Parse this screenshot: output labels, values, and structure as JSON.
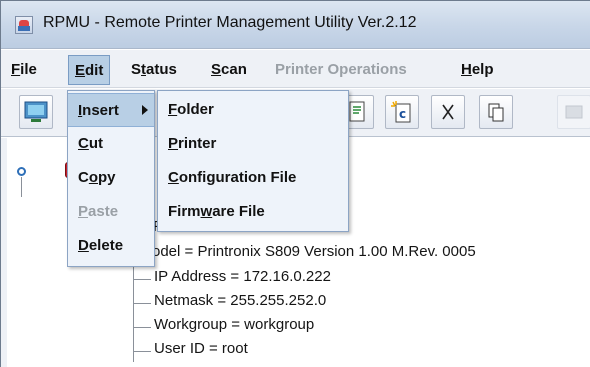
{
  "window": {
    "title": "RPMU - Remote Printer Management Utility Ver.2.12"
  },
  "menubar": {
    "file": {
      "pre": "",
      "u": "F",
      "post": "ile"
    },
    "edit": {
      "pre": "",
      "u": "E",
      "post": "dit"
    },
    "status": {
      "pre": "S",
      "u": "t",
      "post": "atus"
    },
    "scan": {
      "pre": "",
      "u": "S",
      "post": "can"
    },
    "printer_operations": "Printer Operations",
    "help": {
      "pre": "",
      "u": "H",
      "post": "elp"
    }
  },
  "toolbar": {
    "icons": [
      "network-icon",
      "configuration-file-icon",
      "new-configuration-icon",
      "cut-icon",
      "copy-icon",
      "disabled-tool-icon"
    ]
  },
  "edit_menu": {
    "insert": {
      "pre": "",
      "u": "I",
      "post": "nsert"
    },
    "cut": {
      "pre": "",
      "u": "C",
      "post": "ut"
    },
    "copy": {
      "pre": "C",
      "u": "o",
      "post": "py"
    },
    "paste": {
      "pre": "",
      "u": "P",
      "post": "aste"
    },
    "delete": {
      "pre": "",
      "u": "D",
      "post": "elete"
    }
  },
  "insert_submenu": {
    "folder": {
      "pre": "",
      "u": "F",
      "post": "older"
    },
    "printer": {
      "pre": "",
      "u": "P",
      "post": "rinter"
    },
    "configuration_file": {
      "pre": "",
      "u": "C",
      "post": "onfiguration File"
    },
    "firmware_file": {
      "pre": "Firm",
      "u": "w",
      "post": "are File"
    }
  },
  "tree": {
    "partial_label": "Printronix S809",
    "model": "odel = Printronix S809 Version  1.00 M.Rev. 0005",
    "ip_address": "IP Address = 172.16.0.222",
    "netmask": "Netmask = 255.255.252.0",
    "workgroup": "Workgroup = workgroup",
    "user_id": "User ID = root"
  }
}
